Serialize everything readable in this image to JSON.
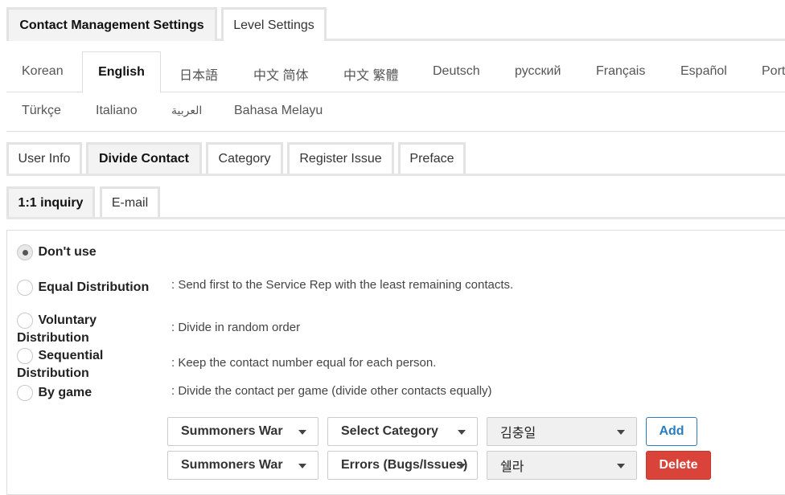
{
  "top_tabs": [
    {
      "label": "Contact Management Settings",
      "active": true
    },
    {
      "label": "Level Settings",
      "active": false
    }
  ],
  "languages_row1": [
    {
      "label": "Korean",
      "active": false
    },
    {
      "label": "English",
      "active": true
    },
    {
      "label": "日本語",
      "active": false
    },
    {
      "label": "中文 简体",
      "active": false
    },
    {
      "label": "中文 繁體",
      "active": false
    },
    {
      "label": "Deutsch",
      "active": false
    },
    {
      "label": "русский",
      "active": false
    },
    {
      "label": "Français",
      "active": false
    },
    {
      "label": "Español",
      "active": false
    },
    {
      "label": "Port",
      "active": false
    }
  ],
  "languages_row2": [
    {
      "label": "Türkçe"
    },
    {
      "label": "Italiano"
    },
    {
      "label": "العربية"
    },
    {
      "label": "Bahasa Melayu"
    }
  ],
  "section_tabs": [
    {
      "label": "User Info",
      "active": false
    },
    {
      "label": "Divide Contact",
      "active": true
    },
    {
      "label": "Category",
      "active": false
    },
    {
      "label": "Register Issue",
      "active": false
    },
    {
      "label": "Preface",
      "active": false
    }
  ],
  "channel_tabs": [
    {
      "label": "1:1 inquiry",
      "active": true
    },
    {
      "label": "E-mail",
      "active": false
    }
  ],
  "options": {
    "dont_use": {
      "label": "Don't use",
      "checked": true
    },
    "equal": {
      "label": "Equal Distribution",
      "desc": ": Send first to the Service Rep with the least remaining contacts.",
      "checked": false
    },
    "voluntary": {
      "label_line1": "Voluntary",
      "label_line2": "Distribution",
      "desc": ": Divide in random order",
      "checked": false
    },
    "sequential": {
      "label_line1": "Sequential",
      "label_line2": "Distribution",
      "desc": ": Keep the contact number equal for each person.",
      "checked": false
    },
    "by_game": {
      "label": "By game",
      "desc": ": Divide the contact per game (divide other contacts equally)",
      "checked": false
    }
  },
  "game_rows": [
    {
      "game": "Summoners War",
      "category": "Select Category",
      "rep": "김충일",
      "button": "Add"
    },
    {
      "game": "Summoners War",
      "category": "Errors (Bugs/Issues)",
      "rep": "쉘라",
      "button": "Delete"
    }
  ],
  "colors": {
    "add_button": "#2a7dbf",
    "delete_button": "#d9433a"
  }
}
